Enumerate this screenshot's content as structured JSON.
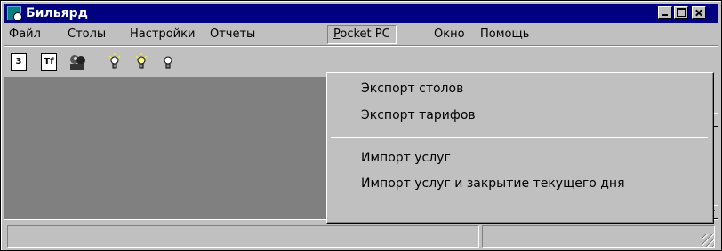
{
  "window": {
    "title": "Бильярд",
    "title_bar_color": "#000080",
    "controls": [
      "minimize-icon",
      "maximize-icon",
      "close-icon"
    ]
  },
  "menubar": {
    "items": [
      {
        "label": "Файл"
      },
      {
        "label": "Столы"
      },
      {
        "label": "Настройки"
      },
      {
        "label": "Отчеты"
      },
      {
        "label": "Pocket PC",
        "underline": "P",
        "rest": "ocket PC",
        "open": true
      },
      {
        "label": "Окно"
      },
      {
        "label": "Помощь"
      }
    ]
  },
  "toolbar": {
    "buttons": [
      {
        "icon": "document-icon",
        "glyph": "3"
      },
      {
        "icon": "tariff-document-icon",
        "glyph": "Tf"
      },
      {
        "icon": "people-icon"
      },
      {
        "icon": "lightbulb-on-icon"
      },
      {
        "icon": "lightbulb-on-icon"
      },
      {
        "icon": "lightbulb-off-icon"
      }
    ]
  },
  "pocket_pc_menu": {
    "items": [
      {
        "label": "Экспорт столов"
      },
      {
        "label": "Экспорт тарифов"
      },
      {
        "label": "Импорт услуг"
      },
      {
        "label": "Импорт услуг и закрытие текущего дня"
      }
    ]
  },
  "colors": {
    "face": "#c0c0c0",
    "workspace": "#808080"
  }
}
